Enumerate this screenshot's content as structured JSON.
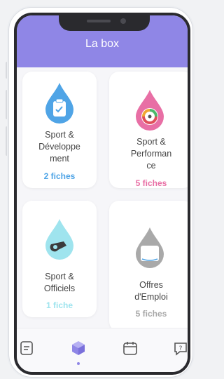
{
  "header": {
    "title": "La box"
  },
  "cards": [
    {
      "label": "Sport &\nDéveloppe\nment",
      "count": "2 fiches",
      "color": "#4fa4e6",
      "icon": "development-clipboard-icon"
    },
    {
      "label": "Sport &\nPerforman\nce",
      "count": "5 fiches",
      "color": "#e86fa5",
      "icon": "performance-gauge-icon"
    },
    {
      "label": "Sport &\nOfficiels",
      "count": "1 fiche",
      "color": "#9fe4ee",
      "icon": "whistle-icon"
    },
    {
      "label": "Offres\nd'Emploi",
      "count": "5 fiches",
      "color": "#a9a9a9",
      "icon": "ffn-logo-icon"
    }
  ],
  "tabs": [
    {
      "icon": "document-icon"
    },
    {
      "icon": "box-icon",
      "active": true
    },
    {
      "icon": "calendar-icon"
    },
    {
      "icon": "help-chat-icon"
    }
  ],
  "colors": {
    "accent": "#8f86e6"
  }
}
